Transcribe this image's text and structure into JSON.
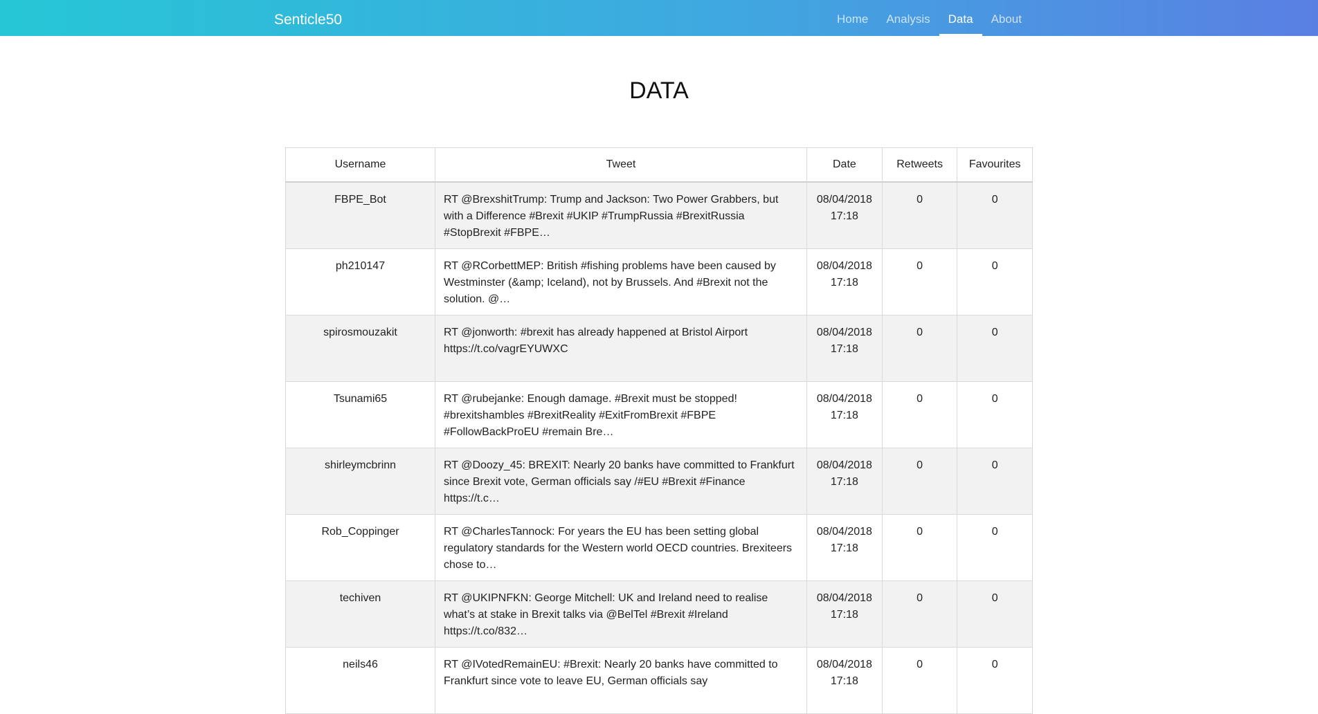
{
  "navbar": {
    "brand": "Senticle50",
    "links": [
      "Home",
      "Analysis",
      "Data",
      "About"
    ],
    "active": "Data"
  },
  "page": {
    "title": "DATA"
  },
  "table": {
    "headers": [
      "Username",
      "Tweet",
      "Date",
      "Retweets",
      "Favourites"
    ],
    "rows": [
      {
        "username": "FBPE_Bot",
        "tweet": "RT @BrexshitTrump: Trump and Jackson: Two Power Grabbers, but with a Difference #Brexit #UKIP #TrumpRussia #BrexitRussia #StopBrexit #FBPE…",
        "date": "08/04/2018 17:18",
        "retweets": "0",
        "favourites": "0"
      },
      {
        "username": "ph210147",
        "tweet": "RT @RCorbettMEP: British #fishing problems have been caused by Westminster (&amp; Iceland), not by Brussels. And #Brexit not the solution. @…",
        "date": "08/04/2018 17:18",
        "retweets": "0",
        "favourites": "0"
      },
      {
        "username": "spirosmouzakit",
        "tweet": "RT @jonworth: #brexit has already happened at Bristol Airport https://t.co/vagrEYUWXC",
        "date": "08/04/2018 17:18",
        "retweets": "0",
        "favourites": "0"
      },
      {
        "username": "Tsunami65",
        "tweet": "RT @rubejanke: Enough damage. #Brexit must be stopped! #brexitshambles #BrexitReality #ExitFromBrexit #FBPE #FollowBackProEU #remain Bre…",
        "date": "08/04/2018 17:18",
        "retweets": "0",
        "favourites": "0"
      },
      {
        "username": "shirleymcbrinn",
        "tweet": "RT @Doozy_45: BREXIT: Nearly 20 banks have committed to Frankfurt since Brexit vote, German officials say /#EU #Brexit #Finance https://t.c…",
        "date": "08/04/2018 17:18",
        "retweets": "0",
        "favourites": "0"
      },
      {
        "username": "Rob_Coppinger",
        "tweet": "RT @CharlesTannock: For years the EU has been setting global regulatory standards for the Western world OECD countries. Brexiteers chose to…",
        "date": "08/04/2018 17:18",
        "retweets": "0",
        "favourites": "0"
      },
      {
        "username": "techiven",
        "tweet": "RT @UKIPNFKN: George Mitchell: UK and Ireland need to realise what’s at stake in Brexit talks via @BelTel #Brexit #Ireland https://t.co/832…",
        "date": "08/04/2018 17:18",
        "retweets": "0",
        "favourites": "0"
      },
      {
        "username": "neils46",
        "tweet": "RT @IVotedRemainEU: #Brexit: Nearly 20 banks have committed to Frankfurt since vote to leave EU, German officials say",
        "date": "08/04/2018 17:18",
        "retweets": "0",
        "favourites": "0"
      }
    ]
  }
}
